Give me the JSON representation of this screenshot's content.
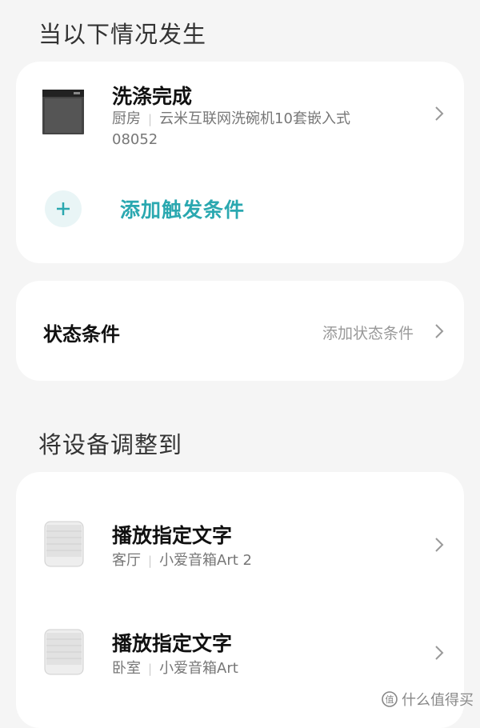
{
  "sections": {
    "trigger_title": "当以下情况发生",
    "action_title": "将设备调整到"
  },
  "trigger": {
    "title": "洗涤完成",
    "room": "厨房",
    "device_line1": "云米互联网洗碗机10套嵌入式",
    "device_line2": "08052",
    "add_label": "添加触发条件"
  },
  "state": {
    "label": "状态条件",
    "action": "添加状态条件"
  },
  "actions": [
    {
      "title": "播放指定文字",
      "room": "客厅",
      "device": "小爱音箱Art 2"
    },
    {
      "title": "播放指定文字",
      "room": "卧室",
      "device": "小爱音箱Art"
    }
  ],
  "watermark": "什么值得买",
  "colors": {
    "accent": "#2aa8b0",
    "background": "#f5f5f5",
    "card": "#ffffff"
  }
}
